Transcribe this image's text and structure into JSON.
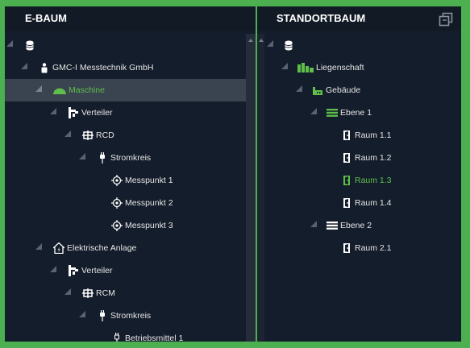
{
  "left": {
    "title": "E-BAUM",
    "rows": [
      {
        "label": "",
        "level": 0,
        "icon": "database-icon"
      },
      {
        "label": "GMC-I Messtechnik GmbH",
        "level": 1,
        "icon": "company-icon"
      },
      {
        "label": "Maschine",
        "level": 2,
        "icon": "machine-icon",
        "selected": true
      },
      {
        "label": "Verteiler",
        "level": 3,
        "icon": "distributor-icon"
      },
      {
        "label": "RCD",
        "level": 4,
        "icon": "rcd-icon"
      },
      {
        "label": "Stromkreis",
        "level": 5,
        "icon": "circuit-icon"
      },
      {
        "label": "Messpunkt 1",
        "level": 6,
        "icon": "measuring-point-icon",
        "leaf": true
      },
      {
        "label": "Messpunkt 2",
        "level": 6,
        "icon": "measuring-point-icon",
        "leaf": true
      },
      {
        "label": "Messpunkt 3",
        "level": 6,
        "icon": "measuring-point-icon",
        "leaf": true
      },
      {
        "label": "Elektrische Anlage",
        "level": 2,
        "icon": "electrical-system-icon"
      },
      {
        "label": "Verteiler",
        "level": 3,
        "icon": "distributor-icon"
      },
      {
        "label": "RCM",
        "level": 4,
        "icon": "rcm-icon"
      },
      {
        "label": "Stromkreis",
        "level": 5,
        "icon": "circuit-icon"
      },
      {
        "label": "Betriebsmittel 1",
        "level": 6,
        "icon": "equipment-icon",
        "leaf": true
      }
    ]
  },
  "right": {
    "title": "STANDORTBAUM",
    "rows": [
      {
        "label": "",
        "level": 0,
        "icon": "database-icon"
      },
      {
        "label": "Liegenschaft",
        "level": 1,
        "icon": "property-icon"
      },
      {
        "label": "Gebäude",
        "level": 2,
        "icon": "building-icon"
      },
      {
        "label": "Ebene 1",
        "level": 3,
        "icon": "floor-icon"
      },
      {
        "label": "Raum 1.1",
        "level": 4,
        "icon": "room-icon",
        "leaf": true
      },
      {
        "label": "Raum 1.2",
        "level": 4,
        "icon": "room-icon",
        "leaf": true
      },
      {
        "label": "Raum 1.3",
        "level": 4,
        "icon": "room-icon",
        "leaf": true,
        "active": true
      },
      {
        "label": "Raum 1.4",
        "level": 4,
        "icon": "room-icon",
        "leaf": true
      },
      {
        "label": "Ebene 2",
        "level": 3,
        "icon": "floor-icon"
      },
      {
        "label": "Raum 2.1",
        "level": 4,
        "icon": "room-icon",
        "leaf": true
      }
    ]
  },
  "colors": {
    "accent_green": "#5fbf4a",
    "frame_green": "#4caf50",
    "panel_bg": "#141d2b",
    "selected_row": "#3a4350"
  }
}
